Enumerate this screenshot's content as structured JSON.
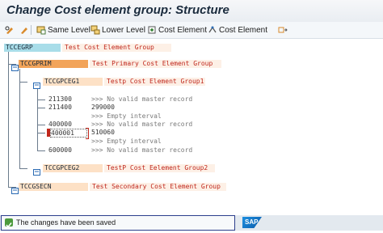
{
  "window": {
    "title": "Change Cost element group: Structure"
  },
  "toolbar": {
    "same_level": "Same Level",
    "lower_level": "Lower Level",
    "cost_element_1": "Cost Element",
    "cost_element_2": "Cost Element"
  },
  "tree": {
    "root": {
      "id": "TCCEGRP",
      "desc": "Test Cost Element Group"
    },
    "primary": {
      "id": "TCCGPRIM",
      "desc": "Test Primary Cost Element Group"
    },
    "group1": {
      "id": "TCCGPCEG1",
      "desc": "Testp Cost Element Group1"
    },
    "leaves": [
      {
        "from": "211300",
        "to": "",
        "msg": ">>> No valid master record"
      },
      {
        "from": "211400",
        "to": "299000",
        "msg": ">>> Empty interval"
      },
      {
        "from": "400000",
        "to": "",
        "msg": ">>> No valid master record"
      },
      {
        "from": "400001",
        "to": "510060",
        "msg": ">>> Empty interval"
      },
      {
        "from": "600000",
        "to": "",
        "msg": ">>> No valid master record"
      }
    ],
    "group2": {
      "id": "TCCGPCEG2",
      "desc": "TestP Cost Eelement Group2"
    },
    "secondary": {
      "id": "TCCGSECN",
      "desc": "Test Secondary Cost Element Group"
    }
  },
  "status": {
    "message": "The changes have been saved"
  },
  "branding": {
    "logo_text": "SAP"
  },
  "colors": {
    "root_highlight": "#a8dde9",
    "primary_highlight": "#f2a45a",
    "group_highlight": "#fde1c6",
    "desc_text": "#c0271c",
    "status_border": "#2c3e8c"
  }
}
